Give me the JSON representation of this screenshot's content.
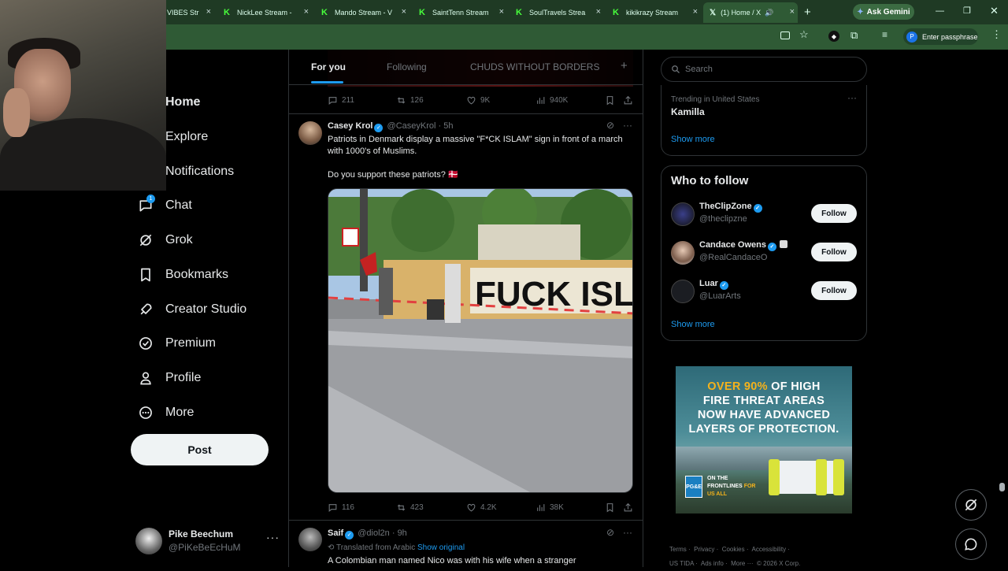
{
  "browser": {
    "tabs": [
      {
        "label": "VIBES Str"
      },
      {
        "label": "NickLee Stream -"
      },
      {
        "label": "Mando Stream - V"
      },
      {
        "label": "SaintTenn Stream"
      },
      {
        "label": "SoulTravels Strea"
      },
      {
        "label": "kikikrazy Stream"
      },
      {
        "label": "(1) Home / X"
      }
    ],
    "gemini_label": "Ask Gemini",
    "passphrase_label": "Enter passphrase",
    "profile_initial": "P"
  },
  "sidebar": {
    "items": [
      {
        "label": "Home",
        "icon": "home-icon"
      },
      {
        "label": "Explore",
        "icon": "search-icon"
      },
      {
        "label": "Notifications",
        "icon": "bell-icon"
      },
      {
        "label": "Chat",
        "icon": "chat-icon",
        "badge": "1"
      },
      {
        "label": "Grok",
        "icon": "grok-icon"
      },
      {
        "label": "Bookmarks",
        "icon": "bookmark-icon"
      },
      {
        "label": "Creator Studio",
        "icon": "rocket-icon"
      },
      {
        "label": "Premium",
        "icon": "verified-icon"
      },
      {
        "label": "Profile",
        "icon": "person-icon"
      },
      {
        "label": "More",
        "icon": "more-circle-icon"
      }
    ],
    "post_label": "Post",
    "account": {
      "name": "Pike Beechum",
      "handle": "@PiKeBeEcHuM",
      "more": "···"
    }
  },
  "feed": {
    "tabs": [
      "For you",
      "Following",
      "CHUDS WITHOUT BORDERS"
    ],
    "active_tab": "For you",
    "plus": "+",
    "prev_tweet_actions": {
      "replies": "211",
      "reposts": "126",
      "likes": "9K",
      "views": "940K"
    },
    "tweet1": {
      "name": "Casey Krol",
      "handle": "@CaseyKrol",
      "time": "· 5h",
      "text": "Patriots in Denmark display a massive \"F*CK ISLAM\" sign in front of a march with 1000's of Muslims.",
      "text2": "Do you support these patriots? 🇩🇰",
      "media_sign": "FUCK ISLAM",
      "actions": {
        "replies": "116",
        "reposts": "423",
        "likes": "4.2K",
        "views": "38K"
      }
    },
    "tweet2": {
      "name": "Saif",
      "handle": "@diol2n",
      "time": "· 9h",
      "translated": "Translated from Arabic",
      "show_original": "Show original",
      "text": "A Colombian man named Nico was with his wife when a stranger"
    }
  },
  "right": {
    "search_placeholder": "Search",
    "trending": {
      "context": "Trending in United States",
      "topic": "Kamilla",
      "show_more": "Show more"
    },
    "who_to_follow": {
      "title": "Who to follow",
      "users": [
        {
          "name": "TheClipZone",
          "handle": "@theclipzne",
          "follow": "Follow"
        },
        {
          "name": "Candace Owens",
          "handle": "@RealCandaceO",
          "follow": "Follow"
        },
        {
          "name": "Luar",
          "handle": "@LuarArts",
          "follow": "Follow"
        }
      ],
      "show_more": "Show more"
    },
    "ad": {
      "line1a": "OVER 90%",
      "line1b": " OF HIGH",
      "line2": "FIRE THREAT AREAS",
      "line3": "NOW HAVE ADVANCED",
      "line4": "LAYERS OF PROTECTION.",
      "logo": "PG&E",
      "tag1": "ON THE",
      "tag2": "FRONTLINES",
      "tag3": "FOR",
      "tag4": "US ALL"
    },
    "footer": {
      "terms": "Terms",
      "privacy": "Privacy",
      "cookies": "Cookies",
      "accessibility": "Accessibility",
      "ustida": "US TIDA",
      "adsinfo": "Ads info",
      "more": "More ···",
      "copyright": "© 2026 X Corp."
    }
  }
}
